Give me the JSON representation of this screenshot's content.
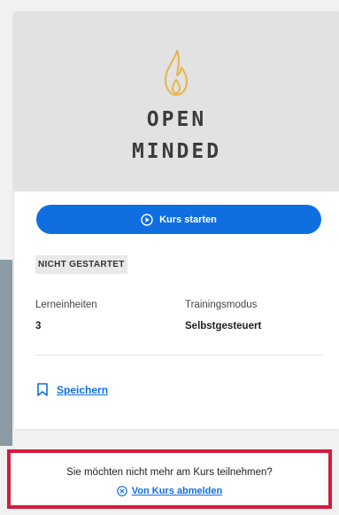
{
  "course": {
    "title_line1": "OPEN",
    "title_line2": "MINDED",
    "start_label": "Kurs starten",
    "status": "NICHT GESTARTET",
    "info": {
      "units_label": "Lerneinheiten",
      "units_value": "3",
      "mode_label": "Trainingsmodus",
      "mode_value": "Selbstgesteuert"
    },
    "save_label": "Speichern"
  },
  "unsubscribe": {
    "question": "Sie möchten nicht mehr am Kurs teilnehmen?",
    "link_label": "Von Kurs abmelden"
  },
  "colors": {
    "accent": "#0f6fe0",
    "hero_bg": "#e2e2e2",
    "flame": "#e8b44a",
    "alert_border": "#d41c3c"
  },
  "icons": [
    "flame-icon",
    "play-circle-icon",
    "bookmark-icon",
    "close-circle-icon"
  ]
}
